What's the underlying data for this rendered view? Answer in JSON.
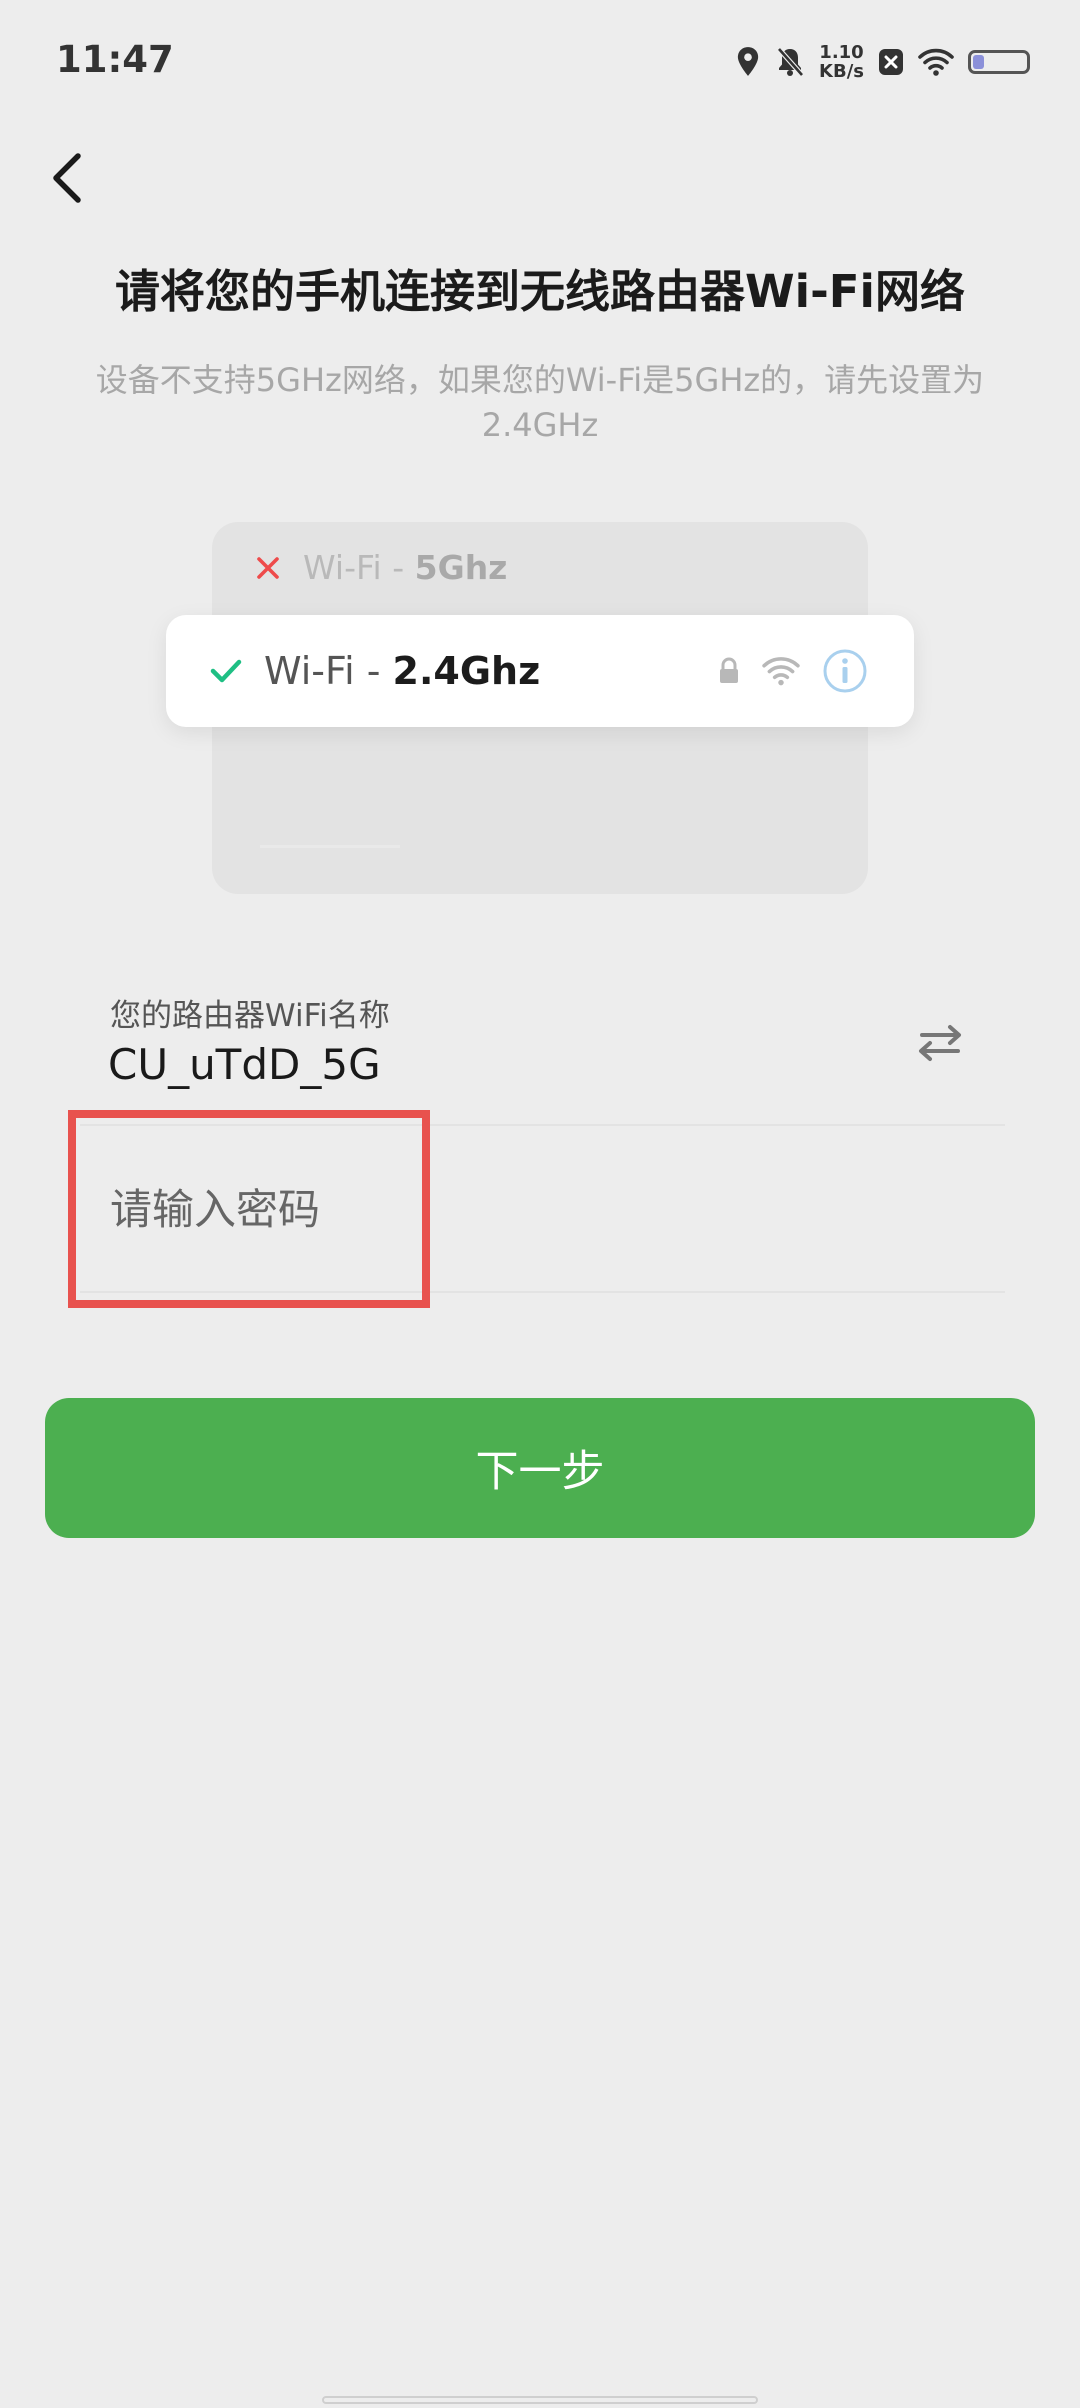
{
  "status_bar": {
    "time": "11:47",
    "net_speed_value": "1.10",
    "net_speed_unit": "KB/s",
    "icons": [
      "location-icon",
      "mute-bell-icon",
      "close-notification-icon",
      "wifi-icon",
      "battery-icon"
    ],
    "battery_level": 0.2
  },
  "header": {
    "back_icon": "chevron-left-icon"
  },
  "main": {
    "title": "请将您的手机连接到无线路由器Wi-Fi网络",
    "subtitle": "设备不支持5GHz网络，如果您的Wi-Fi是5GHz的，请先设置为2.4GHz"
  },
  "illustration": {
    "bad_prefix": "Wi-Fi -",
    "bad_band": "5Ghz",
    "good_prefix": "Wi-Fi -",
    "good_band": "2.4Ghz"
  },
  "form": {
    "wifi_label": "您的路由器WiFi名称",
    "wifi_name": "CU_uTdD_5G",
    "password_placeholder": "请输入密码",
    "password_value": ""
  },
  "actions": {
    "next_label": "下一步"
  },
  "colors": {
    "primary_green": "#4caf50",
    "highlight_red": "#e8524e",
    "background": "#ededed"
  }
}
